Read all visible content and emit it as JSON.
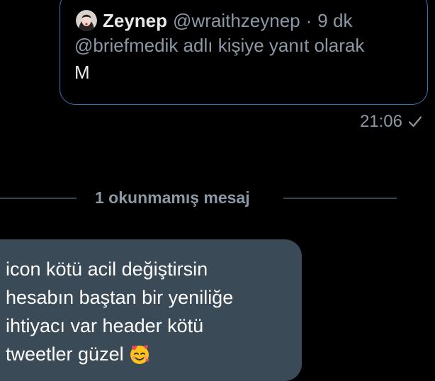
{
  "quoted_tweet": {
    "author_name": "Zeynep",
    "author_handle": "@wraithzeynep",
    "separator": "·",
    "time_ago": "9 dk",
    "reply_context": "@briefmedik adlı kişiye yanıt olarak",
    "text": "M",
    "avatar_icon": "avatar-photo",
    "border_color": "#2f77b5"
  },
  "sent_message": {
    "time": "21:06",
    "status_icon": "check-icon"
  },
  "unread_divider": {
    "label": "1 okunmamış mesaj"
  },
  "incoming_message": {
    "lines": [
      "icon kötü acil değiştirsin",
      "hesabın baştan bir yeniliğe",
      "ihtiyacı var header kötü",
      "tweetler güzel"
    ],
    "emoji_icon": "smiling-face-with-hearts-emoji",
    "bubble_color": "#3b4a57"
  }
}
